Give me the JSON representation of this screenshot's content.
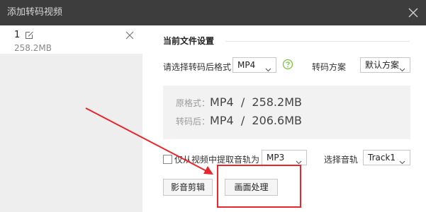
{
  "window": {
    "title": "添加转码视频",
    "close_icon": "close-icon"
  },
  "file_list": [
    {
      "name": "1",
      "size": "258.2MB",
      "edit_icon": "edit-icon",
      "remove_icon": "close-icon"
    }
  ],
  "settings": {
    "section_title": "当前文件设置",
    "format_label": "请选择转码后格式",
    "format_value": "MP4",
    "help_icon": "question-circle-icon",
    "scheme_label": "转码方案",
    "scheme_value": "默认方案"
  },
  "info": {
    "original_label": "原格式：",
    "original_value": "MP4  /  258.2MB",
    "converted_label": "转码后：",
    "converted_value": "MP4  /  206.6MB"
  },
  "audio": {
    "extract_checked": false,
    "extract_label": "仅从视频中提取音轨为",
    "audio_format_value": "MP3",
    "track_label": "选择音轨",
    "track_value": "Track1"
  },
  "buttons": {
    "edit": "影音剪辑",
    "picture": "画面处理"
  },
  "colors": {
    "titlebar": "#3d3d3d",
    "sidebar": "#eeeeee",
    "highlight": "#e8262c",
    "help": "#7dc243"
  }
}
